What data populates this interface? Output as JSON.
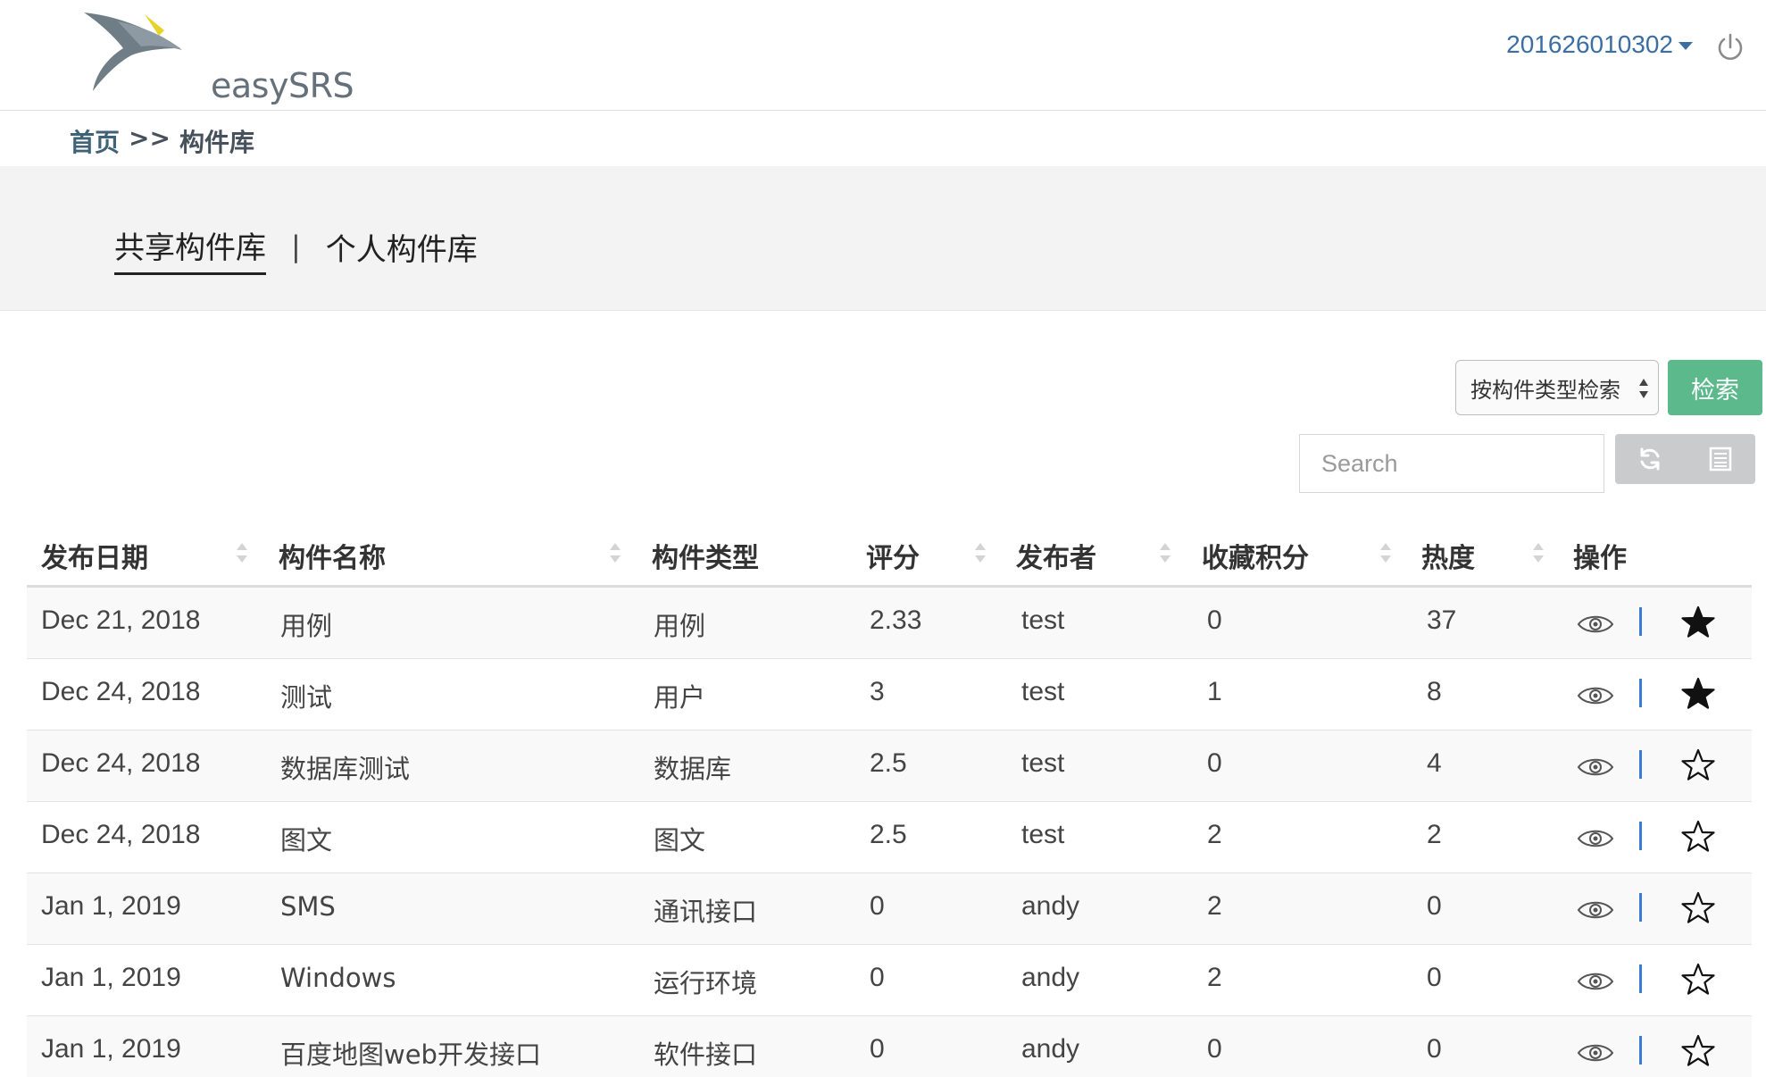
{
  "header": {
    "logo_text": "easySRS",
    "username": "201626010302"
  },
  "breadcrumb": {
    "home": "首页",
    "separator": ">>",
    "current": "构件库"
  },
  "tabs": {
    "items": [
      {
        "label": "共享构件库",
        "active": true
      },
      {
        "label": "个人构件库",
        "active": false
      }
    ],
    "separator": "|"
  },
  "search": {
    "type_select_value": "按构件类型检索",
    "search_button": "检索",
    "placeholder": "Search"
  },
  "table": {
    "columns": [
      "发布日期",
      "构件名称",
      "构件类型",
      "评分",
      "发布者",
      "收藏积分",
      "热度",
      "操作"
    ],
    "rows": [
      {
        "date": "Dec 21, 2018",
        "name": "用例",
        "type": "用例",
        "score": "2.33",
        "publisher": "test",
        "points": "0",
        "heat": "37",
        "favorited": true
      },
      {
        "date": "Dec 24, 2018",
        "name": "测试",
        "type": "用户",
        "score": "3",
        "publisher": "test",
        "points": "1",
        "heat": "8",
        "favorited": true
      },
      {
        "date": "Dec 24, 2018",
        "name": "数据库测试",
        "type": "数据库",
        "score": "2.5",
        "publisher": "test",
        "points": "0",
        "heat": "4",
        "favorited": false
      },
      {
        "date": "Dec 24, 2018",
        "name": "图文",
        "type": "图文",
        "score": "2.5",
        "publisher": "test",
        "points": "2",
        "heat": "2",
        "favorited": false
      },
      {
        "date": "Jan 1, 2019",
        "name": "SMS",
        "type": "通讯接口",
        "score": "0",
        "publisher": "andy",
        "points": "2",
        "heat": "0",
        "favorited": false
      },
      {
        "date": "Jan 1, 2019",
        "name": "Windows",
        "type": "运行环境",
        "score": "0",
        "publisher": "andy",
        "points": "2",
        "heat": "0",
        "favorited": false
      },
      {
        "date": "Jan 1, 2019",
        "name": "百度地图web开发接口",
        "type": "软件接口",
        "score": "0",
        "publisher": "andy",
        "points": "0",
        "heat": "0",
        "favorited": false
      }
    ]
  },
  "colors": {
    "accent_green": "#5cb98c",
    "link_blue": "#3a6ea5",
    "separator_blue": "#3a7bd5",
    "logo_yellow": "#e8d22a",
    "logo_gray": "#6f7d86"
  },
  "icons": {
    "power": "power-icon",
    "refresh": "refresh-icon",
    "columns": "columns-icon",
    "view": "eye-icon",
    "favorite": "star-icon"
  }
}
